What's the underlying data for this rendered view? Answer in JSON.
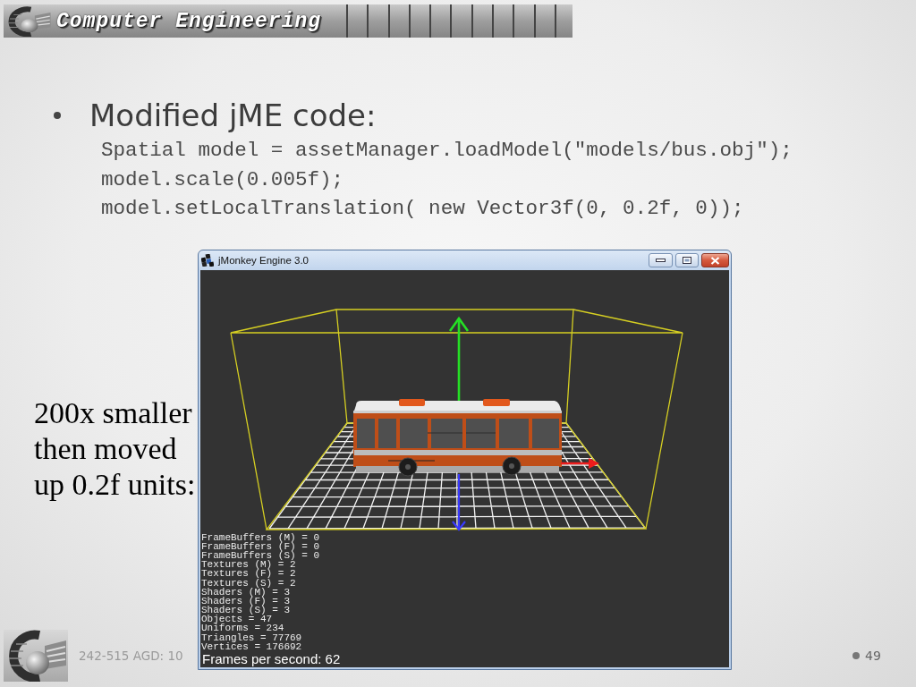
{
  "header": {
    "title": "Computer Engineering"
  },
  "bullet": {
    "text": "Modified jME code:",
    "code_lines": [
      "Spatial model = assetManager.loadModel(\"models/bus.obj\");",
      "model.scale(0.005f);",
      "model.setLocalTranslation( new Vector3f(0, 0.2f, 0));"
    ]
  },
  "caption": "200x smaller then moved up 0.2f units:",
  "window": {
    "title": "jMonkey Engine 3.0",
    "stats": [
      "FrameBuffers (M) = 0",
      "FrameBuffers (F) = 0",
      "FrameBuffers (S) = 0",
      "Textures (M) = 2",
      "Textures (F) = 2",
      "Textures (S) = 2",
      "Shaders (M) = 3",
      "Shaders (F) = 3",
      "Shaders (S) = 3",
      "Objects = 47",
      "Uniforms = 234",
      "Triangles = 77769",
      "Vertices = 176692"
    ],
    "fps": "Frames per second: 62"
  },
  "footer": {
    "course": "242-515 AGD: 10",
    "page": "49"
  }
}
